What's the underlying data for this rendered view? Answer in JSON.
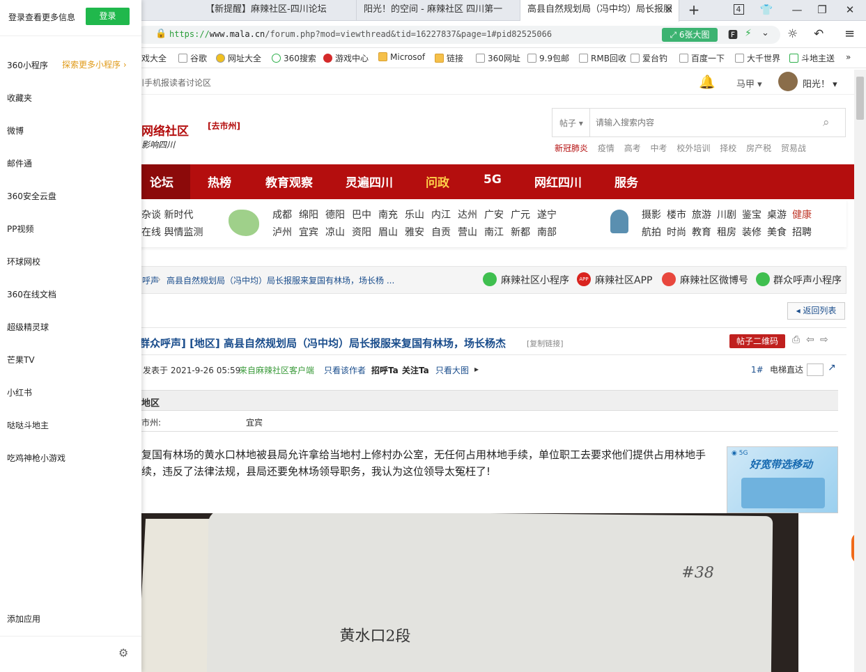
{
  "tabs": [
    {
      "label": "【新提醒】麻辣社区-四川论坛"
    },
    {
      "label": "阳光！的空间 - 麻辣社区 四川第一"
    },
    {
      "label": "高县自然规划局（冯中均）局长报服"
    }
  ],
  "tab_count": "4",
  "address": {
    "scheme": "https://",
    "host": "www.mala.cn",
    "path": "/forum.php?mod=viewthread&tid=16227837&page=1#pid82525066",
    "image_button": "6张大图"
  },
  "bookmarks": [
    "戏大全",
    "谷歌",
    "网址大全",
    "360搜索",
    "游戏中心",
    "Microsof",
    "链接",
    "360网址",
    "9.9包邮",
    "RMB回收",
    "爱台钓",
    "百度一下",
    "大千世界",
    "斗地主送"
  ],
  "site": {
    "top_left": "川手机报读者讨论区",
    "user1": "马甲",
    "user2": "阳光！",
    "logo_text": "网络社区",
    "logo_sub": "影响四川",
    "city_link": "[去市州]",
    "search_scope": "帖子",
    "search_placeholder": "请输入搜索内容",
    "hot_words": [
      "新冠肺炎",
      "疫情",
      "高考",
      "中考",
      "校外培训",
      "择校",
      "房产税",
      "贸易战"
    ],
    "nav": [
      "论坛",
      "热榜",
      "教育观察",
      "灵遍四川",
      "问政",
      "5G",
      "网红四川",
      "服务"
    ],
    "left_links": [
      "杂谈 新时代",
      "在线 舆情监测"
    ],
    "cities_row1": [
      "成都",
      "绵阳",
      "德阳",
      "巴中",
      "南充",
      "乐山",
      "内江",
      "达州",
      "广安",
      "广元",
      "遂宁"
    ],
    "cities_row2": [
      "泸州",
      "宜宾",
      "凉山",
      "资阳",
      "眉山",
      "雅安",
      "自贡",
      "营山",
      "南江",
      "新都",
      "南部"
    ],
    "topics_row1": [
      "摄影",
      "楼市",
      "旅游",
      "川剧",
      "鉴宝",
      "桌游",
      "健康"
    ],
    "topics_row2": [
      "航拍",
      "时尚",
      "教育",
      "租房",
      "装修",
      "美食",
      "招聘"
    ]
  },
  "crumb": {
    "prev": "呼声",
    "title": "高县自然规划局（冯中均）局长报服来复国有林场，场长杨 ...",
    "links": [
      "麻辣社区小程序",
      "麻辣社区APP",
      "麻辣社区微博号",
      "群众呼声小程序"
    ]
  },
  "post": {
    "back": "返回列表",
    "title_prefix": "群众呼声] [地区]",
    "title": "高县自然规划局（冯中均）局长报服来复国有林场，场长杨杰",
    "copy": "[复制链接]",
    "qr": "帖子二维码",
    "meta_time": "发表于 2021-9-26 05:59",
    "meta_src": "来自麻辣社区客户端",
    "meta_links": [
      "只看该作者",
      "招呼Ta",
      "关注Ta",
      "只看大图"
    ],
    "floor": "1#",
    "jump": "电梯直达",
    "section": "地区",
    "field_label": "市州:",
    "field_value": "宜宾",
    "body": "复国有林场的黄水口林地被县局允许拿给当地村上修村办公室，无任何占用林地手续，单位职工去要求他们提供占用林地手续，违反了法律法规，县局还要免林场领导职务，我认为这位领导太冤枉了!",
    "ad": "好宽带选移动"
  },
  "sidebar": {
    "login_text": "登录查看更多信息",
    "login_btn": "登录",
    "miniapp": "360小程序",
    "explore": "探索更多小程序",
    "items": [
      "收藏夹",
      "微博",
      "邮件通",
      "360安全云盘",
      "PP视频",
      "环球网校",
      "360在线文档",
      "超级精灵球",
      "芒果TV",
      "小红书",
      "哒哒斗地主",
      "吃鸡神枪小游戏"
    ],
    "add_app": "添加应用"
  },
  "colors": {
    "brand_red": "#b40e0e",
    "login_green": "#20b84c",
    "link_blue": "#1a4d8c"
  }
}
